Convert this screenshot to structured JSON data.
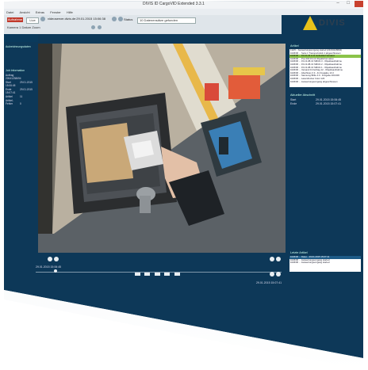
{
  "window": {
    "title": "DIVIS ID CargoVID Extended 3.3.1",
    "controls": "–  □",
    "close_color": "#c8412f"
  },
  "menu": [
    "Datei",
    "Ansicht",
    "Extras",
    "Fenster",
    "Hilfe"
  ],
  "toolbar": {
    "record_label": "Aufnahme",
    "live_label": "Live",
    "address": "videoserver.divis.de:29.01.2015 15:06:38",
    "status_label": "Status",
    "status_value": "10 Datenensätze gefunden",
    "row2": "Kamera 1   Datum   Zoom"
  },
  "brand": {
    "name": "DIVIS",
    "accent": "#e8c21a"
  },
  "left_panel": {
    "section1_title": "Aufzeichnungsdaten",
    "section2_title": "Job Information",
    "rows": [
      {
        "k": "Auftrag",
        "v": "22641238694"
      },
      {
        "k": "Start",
        "v": "29.01.2015 15:06:45"
      },
      {
        "k": "Ende",
        "v": "29.01.2015 15:07:41"
      },
      {
        "k": "Artikel",
        "v": "11"
      },
      {
        "k": "Artikel-Fehler",
        "v": "0"
      }
    ]
  },
  "right_panel": {
    "articles_title": "Artikel",
    "articles": [
      {
        "text": "112/0... Auswertungsvorgang started (22164128694)",
        "highlight": false
      },
      {
        "text": "1026/06 ... Seite 1 Transportstück 1 abgeschlossen",
        "highlight": false
      },
      {
        "text": "1026/06 ... 15-10-23 A 11 Liebeslied Versand",
        "highlight": true
      },
      {
        "text": "1026/06 ... Pos 000 15-13 Objektinformation",
        "highlight": false
      },
      {
        "text": "1026/06 ... 15-13-08-13 SMGS 3 - Objektsaufnahme",
        "highlight": false
      },
      {
        "text": "1026/06 ... 15-13-08-13 SMGS 2 - Objektsaufnahme",
        "highlight": false
      },
      {
        "text": "1026/06 ... 15-13-08-13 SMGS 1 - Objektsaufnahme",
        "highlight": false
      },
      {
        "text": "1026/06 ... Versand 13 Auftrag 12 - Objektsaufnahme",
        "highlight": false
      },
      {
        "text": "1026/06 ... Abschluss 3 3 - 41 Freigabe 13 2",
        "highlight": false
      },
      {
        "text": "1026/06 ... Samsung Brille 4.0 - Freigabe 2013/06",
        "highlight": false
      },
      {
        "text": "1026/06 ... Laserdrucker Color 123",
        "highlight": false
      },
      {
        "text": "1026/06 ... Auswertungsvorgang abgeschlossen",
        "highlight": false
      }
    ],
    "selected_title": "Aktueller Abschnitt",
    "start_label": "Start",
    "start_value": "29.01.2015 15:06:45",
    "end_label": "Ende",
    "end_value": "29.01.2015 15:07:41",
    "log_title": "Letzte Artikel",
    "log": [
      {
        "text": "1026/06 ... Datei... 29.01.2015 15:07:41",
        "selected": true
      },
      {
        "text": "1026/06 ... Auswertungsvorgang started",
        "selected": false
      },
      {
        "text": "1026/06 ... Auswertungsvorgang started",
        "selected": false
      }
    ]
  },
  "timeline": {
    "start_time": "29.01.2015 15:06:45",
    "end_time": "29.01.2015 15:07:41",
    "position": 0.08
  }
}
